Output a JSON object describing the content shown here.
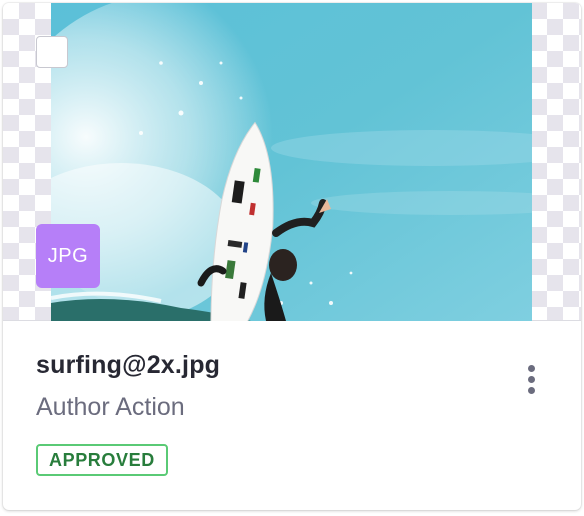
{
  "card": {
    "file_name": "surfing@2x.jpg",
    "subtitle": "Author Action",
    "file_type_badge": "JPG",
    "status": "APPROVED",
    "image_subject": "surfer-photo",
    "actions_icon": "ellipsis-v-icon"
  },
  "colors": {
    "badge_background": "#b67ff8",
    "status_border": "#5aca75",
    "status_text": "#287d3c",
    "title_text": "#272833",
    "subtitle_text": "#6b6c7e"
  }
}
